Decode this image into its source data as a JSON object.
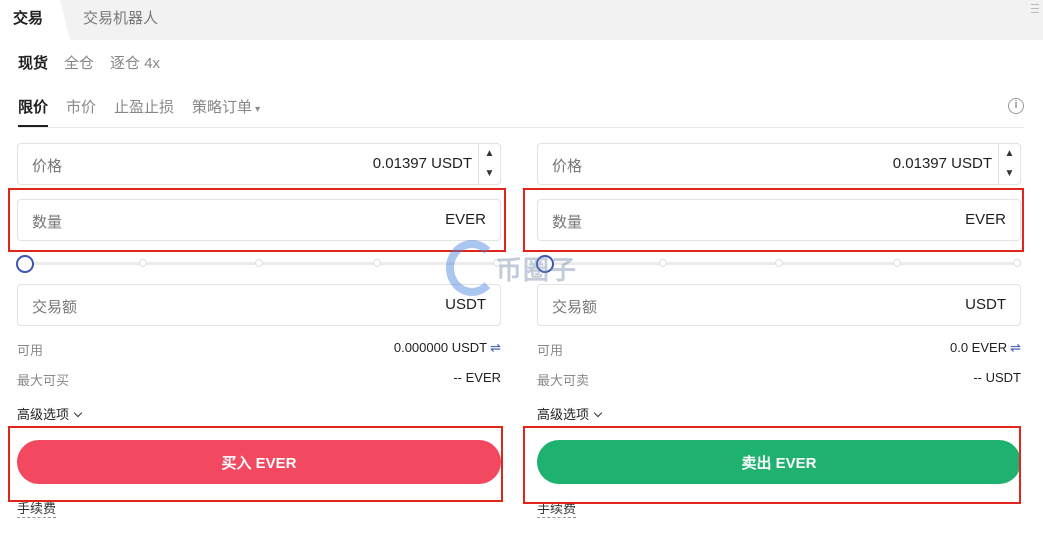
{
  "tabs": {
    "active": "交易",
    "other": "交易机器人"
  },
  "margin_mode": {
    "spot": "现货",
    "cross": "全仓",
    "isolated": "逐仓 4x"
  },
  "order_types": {
    "limit": "限价",
    "market": "市价",
    "tpsl": "止盈止损",
    "strategy": "策略订单"
  },
  "buy": {
    "price_label": "价格",
    "price_value": "0.01397 USDT",
    "qty_label": "数量",
    "qty_unit": "EVER",
    "amount_label": "交易额",
    "amount_unit": "USDT",
    "available_label": "可用",
    "available_value": "0.000000 USDT",
    "max_label": "最大可买",
    "max_value": "-- EVER",
    "advanced_label": "高级选项",
    "button_label": "买入 EVER",
    "fee_label": "手续费",
    "slider_level": 0
  },
  "sell": {
    "price_label": "价格",
    "price_value": "0.01397 USDT",
    "qty_label": "数量",
    "qty_unit": "EVER",
    "amount_label": "交易额",
    "amount_unit": "USDT",
    "available_label": "可用",
    "available_value": "0.0 EVER",
    "max_label": "最大可卖",
    "max_value": "-- USDT",
    "advanced_label": "高级选项",
    "button_label": "卖出 EVER",
    "fee_label": "手续费",
    "slider_level": 0
  },
  "watermark": "币圈子",
  "colors": {
    "buy": "#f24860",
    "sell": "#1fb170",
    "accent": "#3a55b4",
    "highlight": "#e0251b"
  },
  "icons": {
    "stepper_up": "▲",
    "stepper_down": "▼",
    "swap": "⇌",
    "info": "i",
    "caret": "▾"
  }
}
